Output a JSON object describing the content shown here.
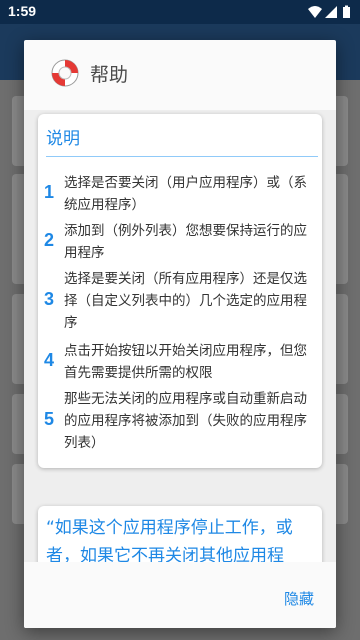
{
  "status_bar": {
    "time": "1:59",
    "icons": [
      "wifi-icon",
      "signal-icon",
      "battery-icon"
    ]
  },
  "dialog": {
    "title": "帮助",
    "icon": "lifebuoy-icon",
    "explain_card": {
      "title": "说明",
      "steps": [
        {
          "num": "1",
          "text": "选择是否要关闭（用户应用程序）或（系统应用程序）"
        },
        {
          "num": "2",
          "text": "添加到（例外列表）您想要保持运行的应用程序"
        },
        {
          "num": "3",
          "text": "选择是要关闭（所有应用程序）还是仅选择（自定义列表中的）几个选定的应用程序"
        },
        {
          "num": "4",
          "text": "点击开始按钮以开始关闭应用程序，但您首先需要提供所需的权限"
        },
        {
          "num": "5",
          "text": "那些无法关闭的应用程序或自动重新启动的应用程序将被添加到（失败的应用程序列表）"
        }
      ]
    },
    "quote_card": {
      "text": "“如果这个应用程序停止工作，或者，如果它不再关闭其他应用程"
    },
    "actions": {
      "hide_label": "隐藏"
    }
  },
  "colors": {
    "accent": "#1e88e5",
    "status_bar": "#0d2a4a",
    "scrim": "#6e6e6e"
  }
}
